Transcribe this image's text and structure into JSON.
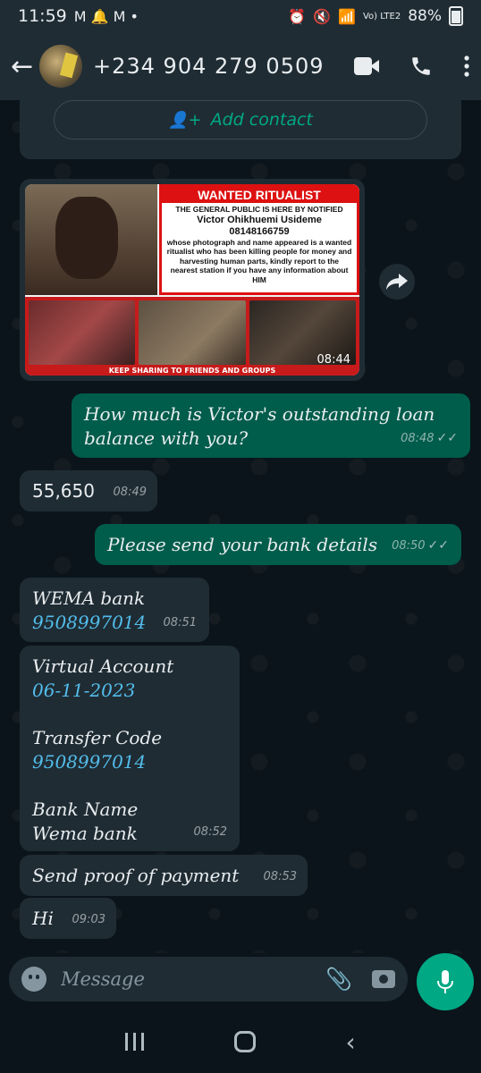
{
  "status_bar": {
    "time": "11:59",
    "left_icons": "M 🔔 M •",
    "network": "Vo) LTE2",
    "battery": "88%"
  },
  "header": {
    "contact": "+234 904 279 0509"
  },
  "add_contact": {
    "label": "Add contact"
  },
  "image_message": {
    "poster_title": "WANTED RITUALIST",
    "poster_line1": "THE GENERAL PUBLIC IS HERE BY NOTIFIED",
    "poster_name": "Victor Ohikhuemi Usideme",
    "poster_phone": "08148166759",
    "poster_text": "whose photograph and name appeared is a wanted ritualist who has been killing people for money and harvesting human parts, kindly report to the nearest station if you have any information about HIM",
    "poster_footer": "KEEP SHARING TO FRIENDS AND GROUPS",
    "time": "08:44"
  },
  "messages": [
    {
      "dir": "out",
      "text": "How much is Victor's outstanding loan balance with you?",
      "time": "08:48"
    },
    {
      "dir": "in",
      "text": "55,650",
      "time": "08:49"
    },
    {
      "dir": "out",
      "text": "Please send your bank details",
      "time": "08:50"
    },
    {
      "dir": "in",
      "line1": "WEMA bank",
      "line2": "9508997014",
      "time": "08:51"
    },
    {
      "dir": "in",
      "line1": "Virtual Account",
      "line2": "06-11-2023",
      "line3": "Transfer Code",
      "line4": "9508997014",
      "line5": "Bank Name",
      "line6": "Wema bank",
      "time": "08:52"
    },
    {
      "dir": "in",
      "text": "Send proof of payment",
      "time": "08:53"
    },
    {
      "dir": "in",
      "text": "Hi",
      "time": "09:03"
    }
  ],
  "input": {
    "placeholder": "Message"
  },
  "colors": {
    "background": "#0b141a",
    "incoming": "#1f2c34",
    "outgoing": "#005c4b",
    "accent": "#00a884",
    "link": "#53bdeb"
  }
}
